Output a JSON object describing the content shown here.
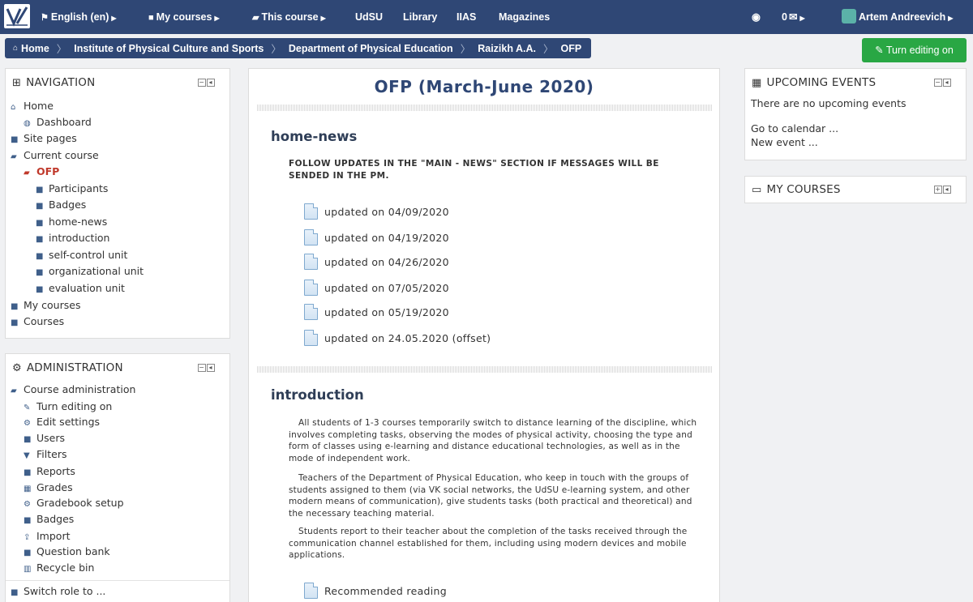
{
  "topbar": {
    "language": "English (en)",
    "my_courses": "My courses",
    "this_course": "This course",
    "links": [
      "UdSU",
      "Library",
      "IIAS",
      "Magazines"
    ],
    "messages_count": "0",
    "user_name": "Artem Andreevich"
  },
  "breadcrumb": [
    "Home",
    "Institute of Physical Culture and Sports",
    "Department of Physical Education",
    "Raizikh A.A.",
    "OFP"
  ],
  "edit_button": "Turn editing on",
  "navigation": {
    "title": "NAVIGATION",
    "items": [
      {
        "label": "Home",
        "icon": "home-icon"
      },
      {
        "label": "Dashboard",
        "icon": "dashboard-icon"
      },
      {
        "label": "Site pages",
        "icon": "folder-icon"
      },
      {
        "label": "Current course",
        "icon": "folder-open-icon"
      },
      {
        "label": "OFP",
        "icon": "folder-open-icon"
      },
      {
        "label": "Participants",
        "icon": "folder-icon"
      },
      {
        "label": "Badges",
        "icon": "folder-icon"
      },
      {
        "label": "home-news",
        "icon": "folder-icon"
      },
      {
        "label": "introduction",
        "icon": "folder-icon"
      },
      {
        "label": "self-control unit",
        "icon": "folder-icon"
      },
      {
        "label": "organizational unit",
        "icon": "folder-icon"
      },
      {
        "label": "evaluation unit",
        "icon": "folder-icon"
      },
      {
        "label": "My courses",
        "icon": "folder-icon"
      },
      {
        "label": "Courses",
        "icon": "folder-icon"
      }
    ]
  },
  "administration": {
    "title": "ADMINISTRATION",
    "items": [
      {
        "label": "Course administration",
        "icon": "folder-open-icon"
      },
      {
        "label": "Turn editing on",
        "icon": "pencil-icon"
      },
      {
        "label": "Edit settings",
        "icon": "gear-icon"
      },
      {
        "label": "Users",
        "icon": "folder-icon"
      },
      {
        "label": "Filters",
        "icon": "filter-icon"
      },
      {
        "label": "Reports",
        "icon": "folder-icon"
      },
      {
        "label": "Grades",
        "icon": "table-icon"
      },
      {
        "label": "Gradebook setup",
        "icon": "gear-icon"
      },
      {
        "label": "Badges",
        "icon": "folder-icon"
      },
      {
        "label": "Import",
        "icon": "upload-icon"
      },
      {
        "label": "Question bank",
        "icon": "folder-icon"
      },
      {
        "label": "Recycle bin",
        "icon": "trash-icon"
      },
      {
        "label": "Switch role to ...",
        "icon": "folder-icon"
      }
    ]
  },
  "main": {
    "course_title": "OFP (March-June 2020)",
    "section1_title": "home-news",
    "section1_summary": "FOLLOW UPDATES IN THE \"MAIN - NEWS\" SECTION IF MESSAGES WILL BE SENDED IN THE PM.",
    "section1_activities": [
      "updated on 04/09/2020",
      "updated on 04/19/2020",
      "updated on 04/26/2020",
      "updated on 07/05/2020",
      "updated on 05/19/2020",
      "updated on 24.05.2020 (offset)"
    ],
    "section2_title": "introduction",
    "section2_paragraphs": [
      "All students of 1-3 courses temporarily switch to distance learning of the discipline, which involves completing tasks, observing the modes of physical activity, choosing the type and form of classes using e-learning and distance educational technologies, as well as in the mode of independent work.",
      "Teachers of the Department of Physical Education, who keep in touch with the groups of students assigned to them (via VK social networks, the UdSU e-learning system, and other modern means of communication), give students tasks (both practical and theoretical) and the necessary teaching material.",
      "Students report to their teacher about the completion of the tasks received through the communication channel established for them, including using modern devices and mobile applications."
    ],
    "section2_activity": "Recommended reading"
  },
  "upcoming_events": {
    "title": "UPCOMING EVENTS",
    "empty_text": "There are no upcoming events",
    "go_to_calendar": "Go to calendar ...",
    "new_event": "New event ..."
  },
  "my_courses_block": {
    "title": "MY COURSES"
  },
  "colors": {
    "navbar": "#2f4775",
    "edit_button": "#29a744",
    "active_item": "#c0392b"
  }
}
